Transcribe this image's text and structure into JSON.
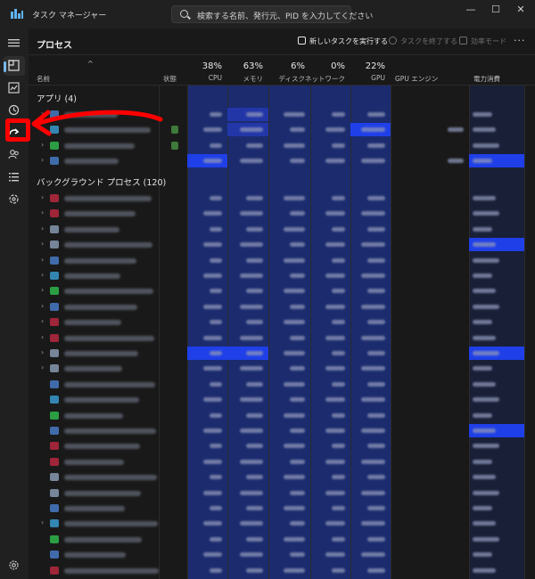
{
  "window": {
    "title": "タスク マネージャー",
    "search_placeholder": "検索する名前、発行元、PID を入力してください",
    "controls": {
      "minimize": "—",
      "maximize": "☐",
      "close": "✕"
    }
  },
  "nav": {
    "items": [
      {
        "id": "menu",
        "icon": "hamburger-icon"
      },
      {
        "id": "processes",
        "icon": "processes-icon",
        "active": true
      },
      {
        "id": "performance",
        "icon": "performance-icon"
      },
      {
        "id": "app-history",
        "icon": "history-icon"
      },
      {
        "id": "startup",
        "icon": "startup-icon"
      },
      {
        "id": "users",
        "icon": "users-icon"
      },
      {
        "id": "details",
        "icon": "details-icon"
      },
      {
        "id": "services",
        "icon": "services-icon"
      }
    ],
    "settings_icon": "gear-icon"
  },
  "toolbar": {
    "title": "プロセス",
    "run_new_task": "新しいタスクを実行する",
    "end_task": "タスクを終了する",
    "efficiency_mode": "効率モード",
    "more": "···"
  },
  "columns": {
    "name": {
      "label": "名前"
    },
    "status": {
      "label": "状態"
    },
    "cpu": {
      "pct": "38%",
      "label": "CPU"
    },
    "memory": {
      "pct": "63%",
      "label": "メモリ"
    },
    "disk": {
      "pct": "6%",
      "label": "ディスク"
    },
    "network": {
      "pct": "0%",
      "label": "ネットワーク"
    },
    "gpu": {
      "pct": "22%",
      "label": "GPU"
    },
    "gpu_engine": {
      "label": "GPU エンジン"
    },
    "power": {
      "label": "電力消費"
    }
  },
  "sections": {
    "apps": "アプリ (4)",
    "background": "バックグラウンド プロセス (120)"
  },
  "colors": {
    "accent": "#76b9ed",
    "heat_low": "#1b2b6e",
    "heat_mid": "#2236a8",
    "heat_high": "#1f3fe8",
    "annotation": "#ff0000"
  }
}
